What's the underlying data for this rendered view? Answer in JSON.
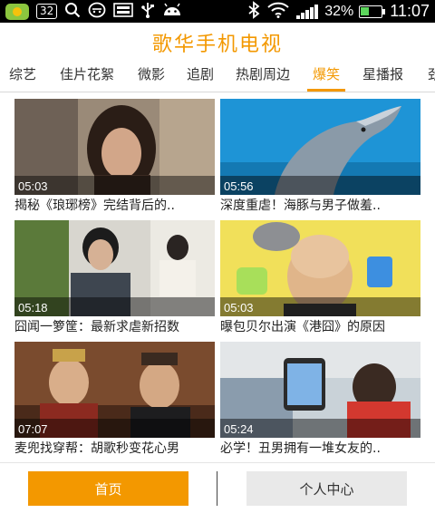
{
  "status_bar": {
    "notification_count": "32",
    "battery_percent": "32%",
    "time": "11:07",
    "icons": [
      "app-icon",
      "search-icon",
      "face-icon",
      "keyboard-icon",
      "usb-icon",
      "android-icon",
      "bluetooth-icon",
      "wifi-icon",
      "signal-icon",
      "battery-icon"
    ]
  },
  "header": {
    "title": "歌华手机电视"
  },
  "tabs": [
    {
      "label": "综艺"
    },
    {
      "label": "佳片花絮"
    },
    {
      "label": "微影"
    },
    {
      "label": "追剧"
    },
    {
      "label": "热剧周边"
    },
    {
      "label": "爆笑",
      "active": true
    },
    {
      "label": "星播报"
    },
    {
      "label": "劲"
    }
  ],
  "videos": [
    {
      "duration": "05:03",
      "title": "揭秘《琅琊榜》完结背后的.."
    },
    {
      "duration": "05:56",
      "title": "深度重虐！海豚与男子做羞.."
    },
    {
      "duration": "05:18",
      "title": "囧闻一箩筐：最新求虐新招数"
    },
    {
      "duration": "05:03",
      "title": "曝包贝尔出演《港囧》的原因"
    },
    {
      "duration": "07:07",
      "title": "麦兜找穿帮：胡歌秒变花心男"
    },
    {
      "duration": "05:24",
      "title": "必学！丑男拥有一堆女友的.."
    }
  ],
  "bottom_nav": {
    "home_label": "首页",
    "profile_label": "个人中心"
  },
  "colors": {
    "accent": "#f39800",
    "status_bar": "#000000",
    "inactive_button": "#e9e9e9"
  }
}
